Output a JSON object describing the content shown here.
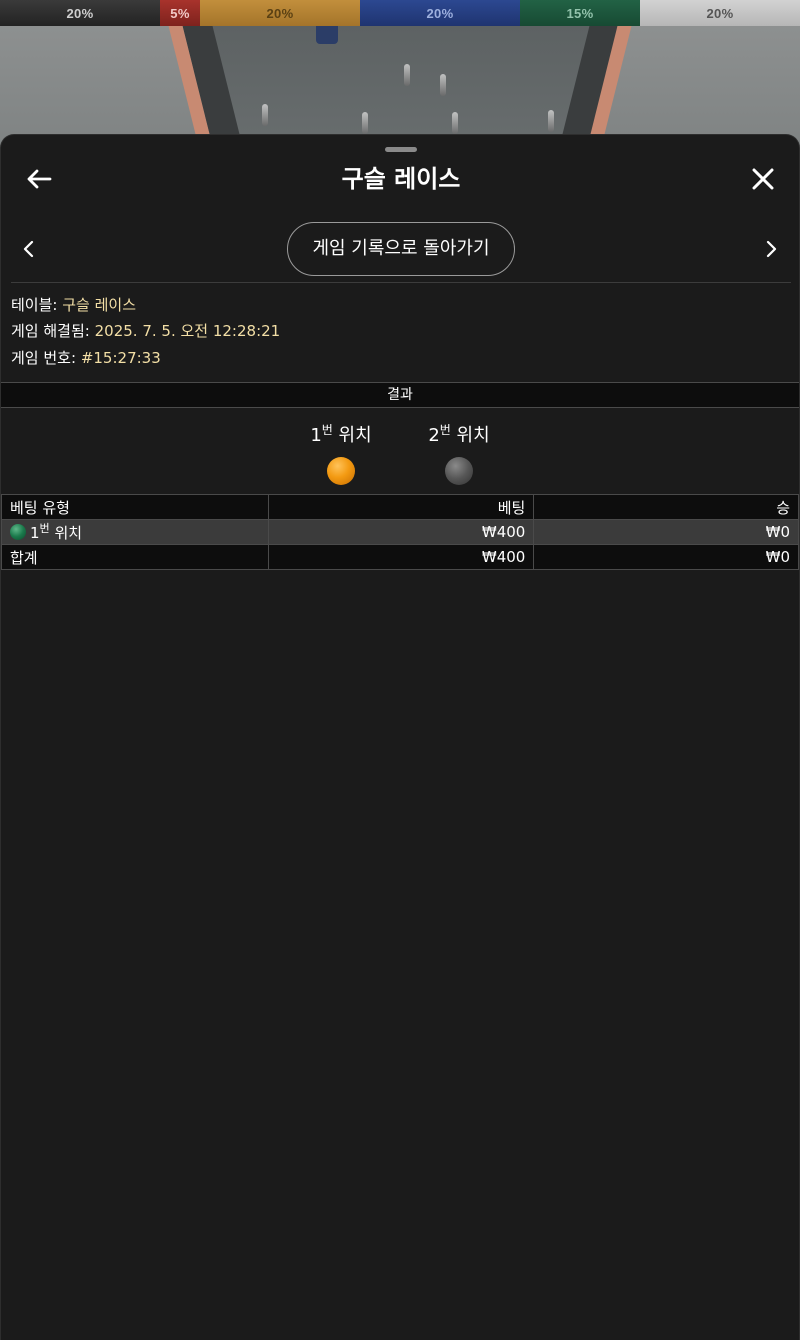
{
  "percent_bar": [
    {
      "label": "20%",
      "color": "#2b2b2b"
    },
    {
      "label": "5%",
      "color": "#a8332c"
    },
    {
      "label": "20%",
      "color": "#c28f3c"
    },
    {
      "label": "20%",
      "color": "#2c4891"
    },
    {
      "label": "15%",
      "color": "#226245"
    },
    {
      "label": "20%",
      "color": "#cfcfcf"
    }
  ],
  "header": {
    "title": "구슬 레이스",
    "back_icon": "arrow-left-icon",
    "close_icon": "close-icon"
  },
  "nav": {
    "history_button": "게임 기록으로 돌아가기",
    "prev_icon": "chevron-left-icon",
    "next_icon": "chevron-right-icon"
  },
  "info": {
    "table_label": "테이블:",
    "table_value": "구슬 레이스",
    "resolved_label": "게임 해결됨:",
    "resolved_value": "2025. 7. 5. 오전 12:28:21",
    "number_label": "게임 번호:",
    "number_value": "#15:27:33"
  },
  "results": {
    "heading": "결과",
    "positions": [
      {
        "num": "1",
        "sup": "번",
        "label": "위치",
        "ball_color": "#f39a12"
      },
      {
        "num": "2",
        "sup": "번",
        "label": "위치",
        "ball_color": "#565656"
      }
    ]
  },
  "bets": {
    "columns": [
      "베팅 유형",
      "베팅",
      "승"
    ],
    "rows": [
      {
        "num": "1",
        "sup": "번",
        "label": "위치",
        "ball_color": "#1b7a4c",
        "bet": "₩400",
        "win": "₩0"
      }
    ],
    "total": {
      "label": "합계",
      "bet": "₩400",
      "win": "₩0"
    }
  }
}
